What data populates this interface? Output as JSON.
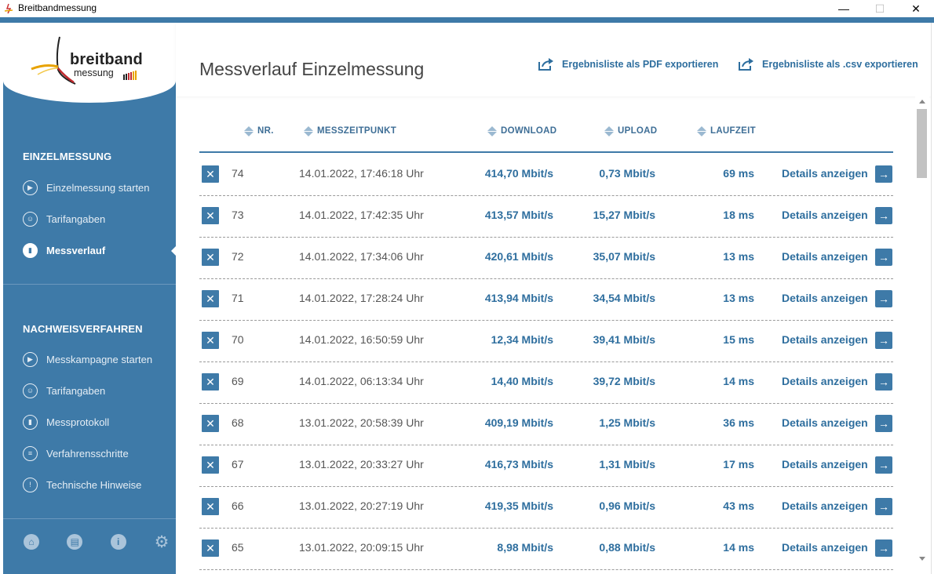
{
  "window": {
    "title": "Breitbandmessung",
    "minimize": "—",
    "maximize": "☐",
    "close": "✕"
  },
  "logo": {
    "word": "breitband",
    "sub": "messung"
  },
  "sidebar": {
    "section1": "EINZELMESSUNG",
    "items1": [
      {
        "label": "Einzelmessung starten",
        "icon": "play-circle-icon"
      },
      {
        "label": "Tarifangaben",
        "icon": "user-card-icon"
      },
      {
        "label": "Messverlauf",
        "icon": "clipboard-icon",
        "active": true
      }
    ],
    "section2": "NACHWEISVERFAHREN",
    "items2": [
      {
        "label": "Messkampagne starten",
        "icon": "play-circle-icon"
      },
      {
        "label": "Tarifangaben",
        "icon": "user-card-icon"
      },
      {
        "label": "Messprotokoll",
        "icon": "clipboard-icon"
      },
      {
        "label": "Verfahrensschritte",
        "icon": "list-icon"
      },
      {
        "label": "Technische Hinweise",
        "icon": "warning-icon"
      }
    ]
  },
  "header": {
    "title": "Messverlauf Einzelmessung",
    "export_pdf": "Ergebnisliste als PDF exportieren",
    "export_csv": "Ergebnisliste als .csv exportieren"
  },
  "table": {
    "columns": {
      "nr": "NR.",
      "time": "MESSZEITPUNKT",
      "download": "DOWNLOAD",
      "upload": "UPLOAD",
      "latency": "LAUFZEIT"
    },
    "details_label": "Details anzeigen",
    "rows": [
      {
        "nr": "74",
        "time": "14.01.2022, 17:46:18 Uhr",
        "download": "414,70 Mbit/s",
        "upload": "0,73 Mbit/s",
        "latency": "69 ms"
      },
      {
        "nr": "73",
        "time": "14.01.2022, 17:42:35 Uhr",
        "download": "413,57 Mbit/s",
        "upload": "15,27 Mbit/s",
        "latency": "18 ms"
      },
      {
        "nr": "72",
        "time": "14.01.2022, 17:34:06 Uhr",
        "download": "420,61 Mbit/s",
        "upload": "35,07 Mbit/s",
        "latency": "13 ms"
      },
      {
        "nr": "71",
        "time": "14.01.2022, 17:28:24 Uhr",
        "download": "413,94 Mbit/s",
        "upload": "34,54 Mbit/s",
        "latency": "13 ms"
      },
      {
        "nr": "70",
        "time": "14.01.2022, 16:50:59 Uhr",
        "download": "12,34 Mbit/s",
        "upload": "39,41 Mbit/s",
        "latency": "15 ms"
      },
      {
        "nr": "69",
        "time": "14.01.2022, 06:13:34 Uhr",
        "download": "14,40 Mbit/s",
        "upload": "39,72 Mbit/s",
        "latency": "14 ms"
      },
      {
        "nr": "68",
        "time": "13.01.2022, 20:58:39 Uhr",
        "download": "409,19 Mbit/s",
        "upload": "1,25 Mbit/s",
        "latency": "36 ms"
      },
      {
        "nr": "67",
        "time": "13.01.2022, 20:33:27 Uhr",
        "download": "416,73 Mbit/s",
        "upload": "1,31 Mbit/s",
        "latency": "17 ms"
      },
      {
        "nr": "66",
        "time": "13.01.2022, 20:27:19 Uhr",
        "download": "419,35 Mbit/s",
        "upload": "0,96 Mbit/s",
        "latency": "43 ms"
      },
      {
        "nr": "65",
        "time": "13.01.2022, 20:09:15 Uhr",
        "download": "8,98 Mbit/s",
        "upload": "0,88 Mbit/s",
        "latency": "14 ms"
      }
    ]
  },
  "footer_icons": [
    "home-icon",
    "chat-icon",
    "info-icon",
    "gear-icon"
  ],
  "colors": {
    "sidebar": "#3e7aa8",
    "accent": "#2e6e9e"
  }
}
